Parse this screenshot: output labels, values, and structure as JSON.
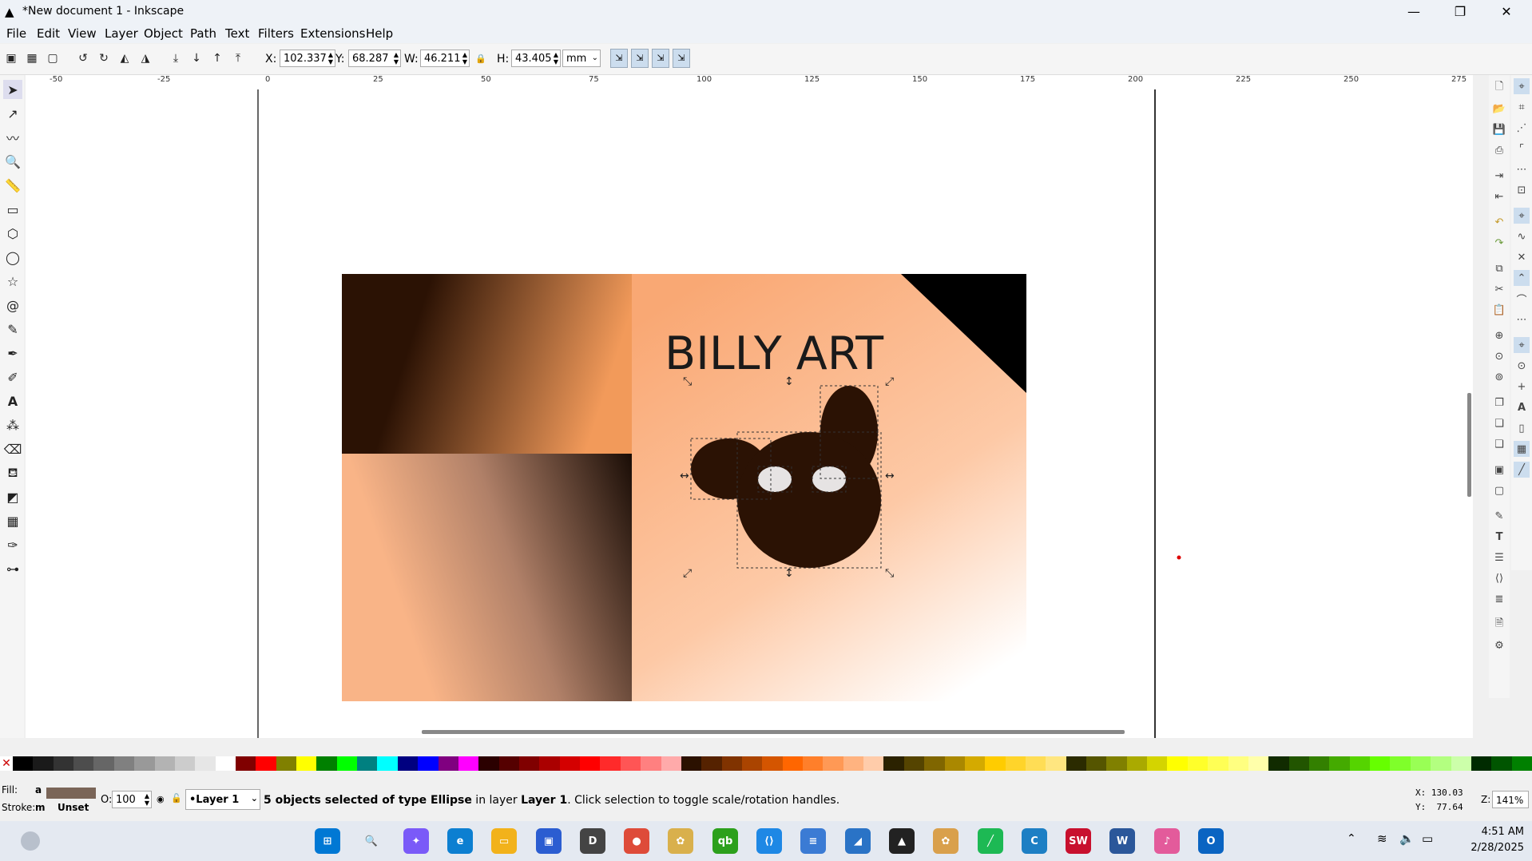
{
  "window": {
    "title": "*New document 1 - Inkscape",
    "controls": [
      "—",
      "❐",
      "✕"
    ]
  },
  "menu": [
    {
      "label": "File"
    },
    {
      "label": "Edit"
    },
    {
      "label": "View"
    },
    {
      "label": "Layer"
    },
    {
      "label": "Object"
    },
    {
      "label": "Path"
    },
    {
      "label": "Text"
    },
    {
      "label": "Filters"
    },
    {
      "label": "Extensions"
    },
    {
      "label": "Help"
    }
  ],
  "toolbar": {
    "x_label": "X:",
    "x_value": "102.337",
    "y_label": "Y:",
    "y_value": "68.287",
    "w_label": "W:",
    "w_value": "46.211",
    "h_label": "H:",
    "h_value": "43.405",
    "unit": "mm"
  },
  "ruler": {
    "top_ticks": [
      "-50",
      "-25",
      "0",
      "25",
      "50",
      "75",
      "100",
      "125",
      "150",
      "175",
      "200",
      "225",
      "250",
      "275"
    ]
  },
  "canvas": {
    "artwork_text": "BILLY ART",
    "colors": {
      "dark_brown": "#2b1204",
      "orange": "#f29a5a",
      "peach": "#fdbf97",
      "eye_white": "#e6e3e3"
    }
  },
  "palette": [
    "#000000",
    "#1a1a1a",
    "#333333",
    "#4d4d4d",
    "#666666",
    "#808080",
    "#999999",
    "#b3b3b3",
    "#cccccc",
    "#e6e6e6",
    "#ffffff",
    "#800000",
    "#ff0000",
    "#808000",
    "#ffff00",
    "#008000",
    "#00ff00",
    "#008080",
    "#00ffff",
    "#000080",
    "#0000ff",
    "#800080",
    "#ff00ff",
    "#2b0000",
    "#550000",
    "#800000",
    "#aa0000",
    "#d40000",
    "#ff0000",
    "#ff2a2a",
    "#ff5555",
    "#ff8080",
    "#ffaaaa",
    "#2b1100",
    "#552200",
    "#803300",
    "#aa4400",
    "#d45500",
    "#ff6600",
    "#ff7f2a",
    "#ff9955",
    "#ffb380",
    "#ffccaa",
    "#2b2200",
    "#554400",
    "#806600",
    "#aa8800",
    "#d4aa00",
    "#ffcc00",
    "#ffd42a",
    "#ffdd55",
    "#ffe680",
    "#2b2b00",
    "#555500",
    "#808000",
    "#aaaa00",
    "#d4d400",
    "#ffff00",
    "#ffff2a",
    "#ffff55",
    "#ffff80",
    "#ffffaa",
    "#112b00",
    "#225500",
    "#338000",
    "#44aa00",
    "#55d400",
    "#66ff00",
    "#7fff2a",
    "#99ff55",
    "#b3ff80",
    "#ccffaa",
    "#002b00",
    "#005500",
    "#008000"
  ],
  "status": {
    "fill_label": "Fill:",
    "fill_value": "a",
    "fill_color": "#7a6558",
    "stroke_label": "Stroke:",
    "stroke_value": "m",
    "stroke_unset": "Unset",
    "opacity_label": "O:",
    "opacity_value": "100",
    "layer_name": "•Layer 1",
    "message_prefix": "5 objects selected of type ",
    "message_type": "Ellipse",
    "message_mid": " in layer ",
    "message_layer": "Layer 1",
    "message_suffix": ". Click selection to toggle scale/rotation handles.",
    "cursor_x": "X: 130.03",
    "cursor_y": "Y:  77.64",
    "zoom_label": "Z:",
    "zoom_value": "141%"
  },
  "taskbar": {
    "time": "4:51 AM",
    "date": "2/28/2025",
    "apps": [
      {
        "name": "start",
        "color": "#0078d4",
        "glyph": "⊞"
      },
      {
        "name": "search",
        "color": "#e4e9f1",
        "glyph": "🔍"
      },
      {
        "name": "copilot",
        "color": "#7a5af8",
        "glyph": "✦"
      },
      {
        "name": "edge",
        "color": "#0c7fd1",
        "glyph": "e"
      },
      {
        "name": "file-explorer",
        "color": "#f2b21b",
        "glyph": "▭"
      },
      {
        "name": "store",
        "color": "#2b5dd1",
        "glyph": "▣"
      },
      {
        "name": "dell",
        "color": "#444444",
        "glyph": "D"
      },
      {
        "name": "chrome",
        "color": "#de4b39",
        "glyph": "●"
      },
      {
        "name": "photos",
        "color": "#d9b04c",
        "glyph": "✿"
      },
      {
        "name": "quickbooks",
        "color": "#2ca01c",
        "glyph": "qb"
      },
      {
        "name": "vscode",
        "color": "#1e88e5",
        "glyph": "⟨⟩"
      },
      {
        "name": "notepad",
        "color": "#3b7bd4",
        "glyph": "≡"
      },
      {
        "name": "paint",
        "color": "#2a73c6",
        "glyph": "◢"
      },
      {
        "name": "inkscape",
        "color": "#222222",
        "glyph": "▲"
      },
      {
        "name": "gallery",
        "color": "#d9a04c",
        "glyph": "✿"
      },
      {
        "name": "app-green",
        "color": "#1db954",
        "glyph": "╱"
      },
      {
        "name": "app-c",
        "color": "#1d7fc4",
        "glyph": "C"
      },
      {
        "name": "solidworks",
        "color": "#c8102e",
        "glyph": "SW"
      },
      {
        "name": "word",
        "color": "#2b579a",
        "glyph": "W"
      },
      {
        "name": "itunes",
        "color": "#e35b9b",
        "glyph": "♪"
      },
      {
        "name": "outlook",
        "color": "#0a64c2",
        "glyph": "O"
      }
    ]
  }
}
